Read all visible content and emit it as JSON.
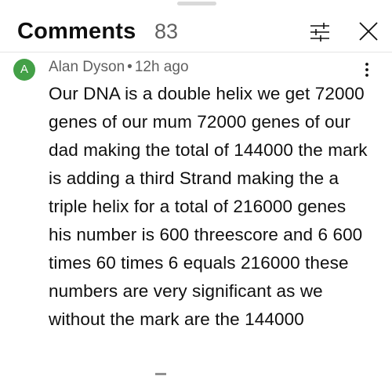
{
  "header": {
    "title": "Comments",
    "count": "83",
    "filter_icon": "filter-sliders-icon",
    "close_icon": "close-icon"
  },
  "comment": {
    "avatar_letter": "A",
    "avatar_color": "#43a047",
    "author": "Alan Dyson",
    "separator": "•",
    "time": "12h ago",
    "more_icon": "more-vert-icon",
    "text": "Our DNA is a double helix we get 72000 genes of our mum 72000 genes of our dad making the total of 144000 the mark is adding a third Strand making the a triple helix for a total of 216000 genes his number is 600 threescore and 6 600 times 60 times 6 equals 216000 these numbers are very significant as we without the mark are the 144000"
  }
}
